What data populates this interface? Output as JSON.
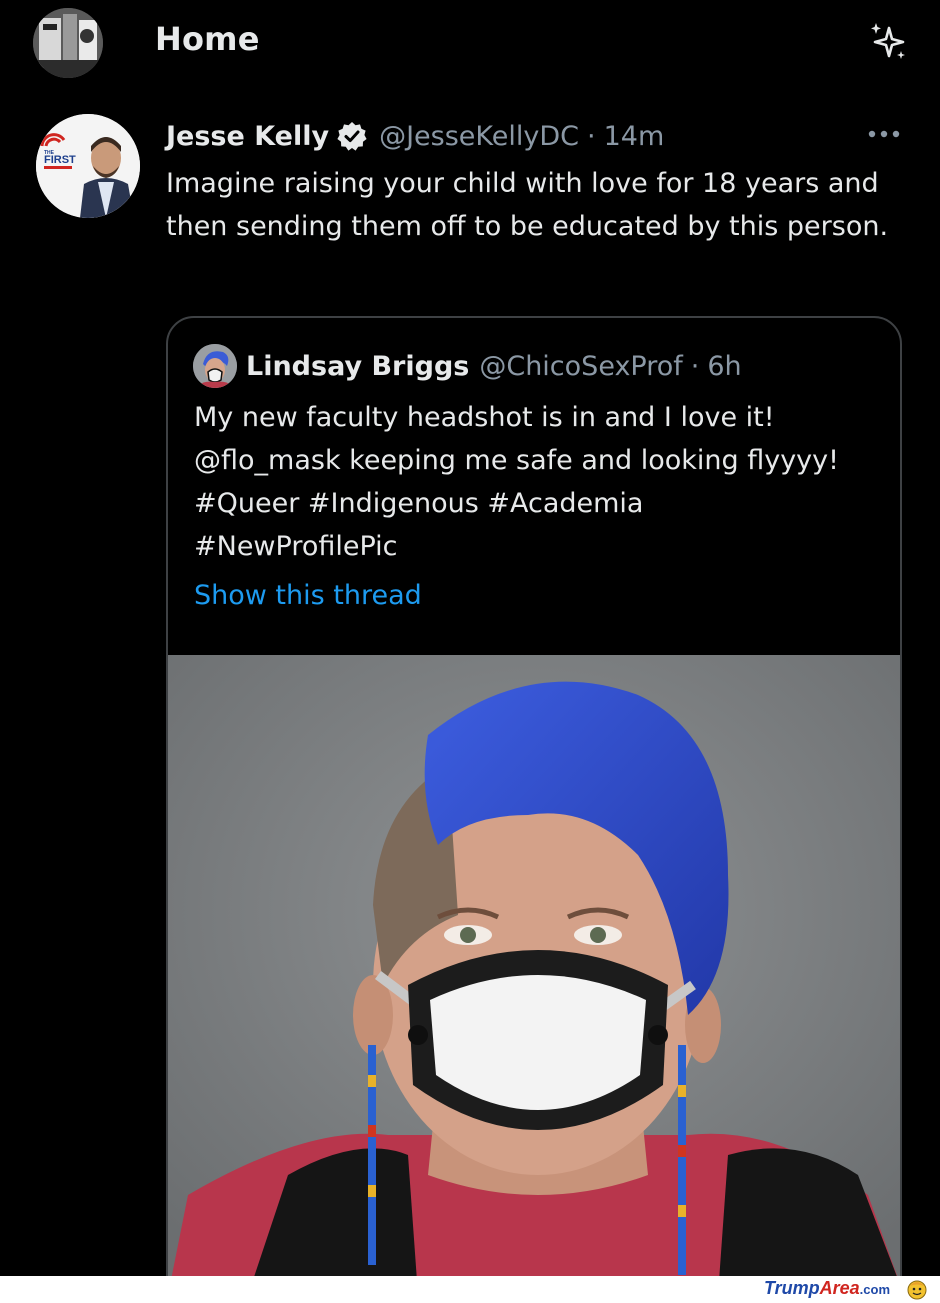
{
  "header": {
    "title": "Home",
    "sparkle_icon": "sparkle-icon"
  },
  "tweet": {
    "author_name": "Jesse Kelly",
    "author_handle": "@JesseKellyDC",
    "separator": "·",
    "time": "14m",
    "text": "Imagine raising your child with love for 18 years and then sending them off to be educated by this person.",
    "avatar_badge_small": "THE",
    "avatar_badge": "FIRST",
    "more_icon": "more-icon",
    "verified_icon": "verified-icon"
  },
  "quote": {
    "author_name": "Lindsay Briggs",
    "author_handle": "@ChicoSexProf",
    "separator": "·",
    "time": "6h",
    "lines": [
      "My new faculty headshot is in and I love it!",
      "@flo_mask keeping me safe and looking flyyyy!",
      "#Queer #Indigenous #Academia",
      "#NewProfilePic"
    ],
    "show_thread": "Show this thread"
  },
  "watermark": {
    "part1": "Trump",
    "part2": "Area",
    "part3": ".com"
  },
  "colors": {
    "background": "#000000",
    "text": "#e7e9ea",
    "secondary": "#8b98a5",
    "link": "#1d9bf0",
    "border": "#3e4144"
  }
}
